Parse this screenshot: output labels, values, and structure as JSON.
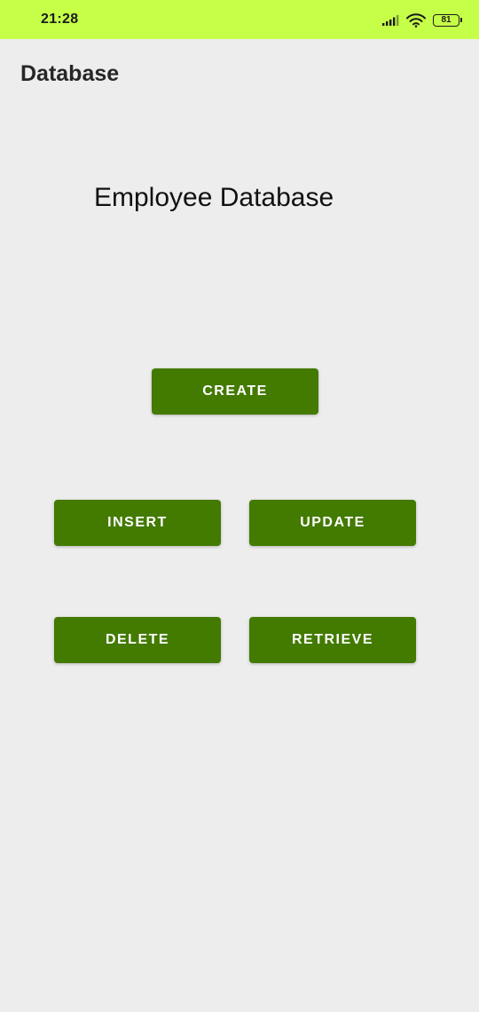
{
  "status_bar": {
    "time": "21:28",
    "battery_level": "81",
    "background_color": "#c6ff48"
  },
  "app_bar": {
    "title": "Database"
  },
  "main": {
    "heading": "Employee Database",
    "buttons": {
      "create": "CREATE",
      "insert": "INSERT",
      "update": "UPDATE",
      "delete": "DELETE",
      "retrieve": "RETRIEVE"
    },
    "button_color": "#437a00"
  },
  "icons": [
    "signal-icon",
    "wifi-icon",
    "battery-icon"
  ]
}
